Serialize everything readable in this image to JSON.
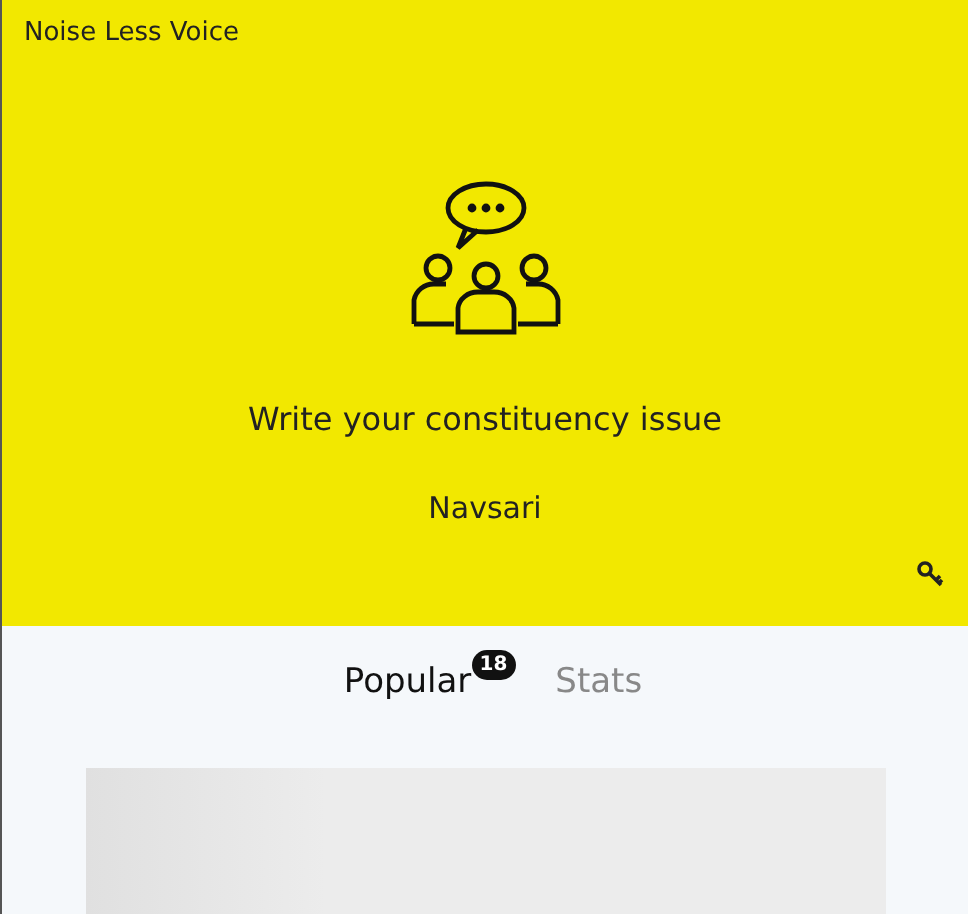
{
  "app_title": "Noise Less Voice",
  "prompt": "Write your constituency issue",
  "constituency": "Navsari",
  "tabs": [
    {
      "label": "Popular",
      "selected": true,
      "badge": "18"
    },
    {
      "label": "Stats",
      "selected": false
    }
  ]
}
